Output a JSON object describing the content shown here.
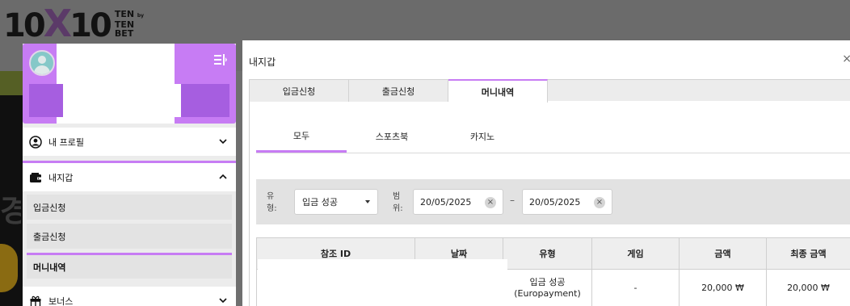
{
  "background": {
    "logo_main": "10X10",
    "logo_stack": [
      "TEN",
      "TEN",
      "BET"
    ],
    "logo_by": "by"
  },
  "sidebar": {
    "menu_icon": "menu-collapse-icon",
    "items": [
      {
        "label": "내 프로필",
        "icon": "user-circle-icon",
        "chevron": "chevron-down-icon"
      },
      {
        "label": "내지갑",
        "icon": "wallet-icon",
        "chevron": "chevron-up-icon"
      },
      {
        "label": "보너스",
        "icon": "gift-icon",
        "chevron": "chevron-down-icon"
      }
    ],
    "wallet_sub": [
      {
        "label": "입금신청"
      },
      {
        "label": "출금신청"
      },
      {
        "label": "머니내역"
      }
    ]
  },
  "panel": {
    "title": "내지갑",
    "close": "×",
    "tabs": [
      "입금신청",
      "출금신청",
      "머니내역"
    ],
    "active_tab": 2,
    "subtabs": [
      "모두",
      "스포츠북",
      "카지노"
    ],
    "active_subtab": 0,
    "filter": {
      "type_label": "유형:",
      "type_value": "입금 성공",
      "range_label": "범위:",
      "date_from": "20/05/2025",
      "date_to": "20/05/2025",
      "dash": "–",
      "clear": "×"
    },
    "table": {
      "headers": [
        "참조 ID",
        "날짜",
        "유형",
        "게임",
        "금액",
        "최종 금액"
      ],
      "rows": [
        {
          "ref": "",
          "date": "",
          "type_line1": "입금 성공",
          "type_line2": "(Europayment)",
          "game": "-",
          "amount": "20,000 ₩",
          "final": "20,000 ₩"
        }
      ]
    }
  },
  "colors": {
    "accent": "#c77cf4",
    "accent_dark": "#a65ee0",
    "overlay": "#6f6f6f"
  }
}
